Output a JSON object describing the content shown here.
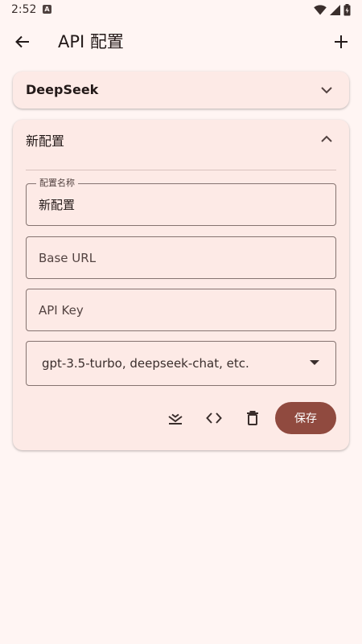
{
  "status_bar": {
    "time": "2:52",
    "notification_glyph": "A"
  },
  "app_bar": {
    "title": "API 配置"
  },
  "cards": [
    {
      "title": "DeepSeek",
      "expanded": false
    },
    {
      "title": "新配置",
      "expanded": true,
      "fields": {
        "name": {
          "label": "配置名称",
          "value": "新配置"
        },
        "base_url": {
          "placeholder": "Base URL"
        },
        "api_key": {
          "placeholder": "API Key"
        },
        "model": {
          "placeholder": "gpt-3.5-turbo, deepseek-chat, etc."
        }
      },
      "actions": {
        "save_label": "保存"
      }
    }
  ],
  "colors": {
    "background": "#fff5f3",
    "card": "#fdeae6",
    "primary": "#904a3f",
    "outline": "#857370"
  }
}
